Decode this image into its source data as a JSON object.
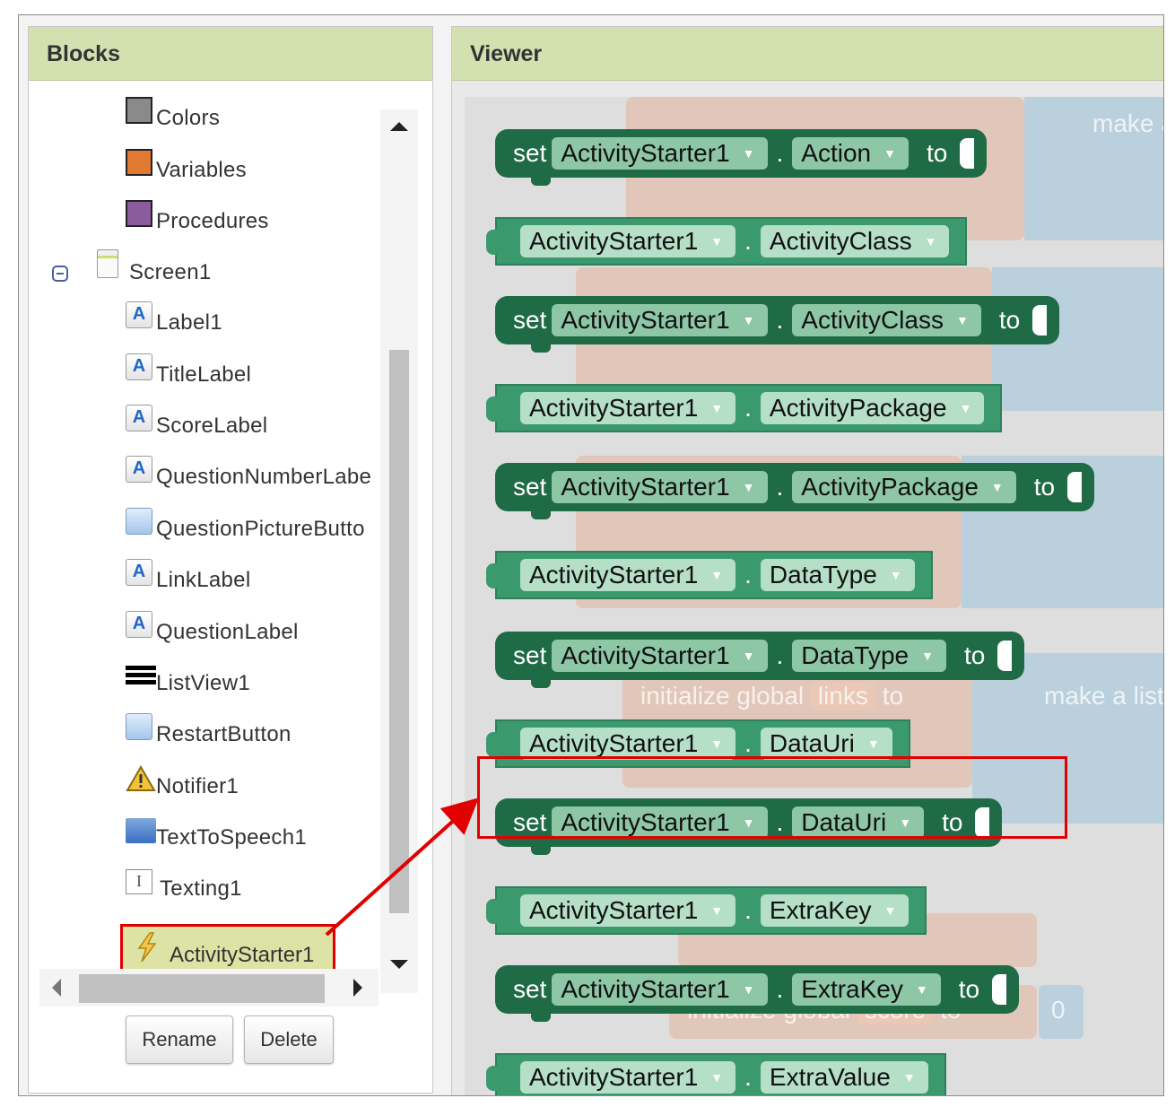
{
  "blocks_panel": {
    "title": "Blocks",
    "built_in": [
      {
        "label": "Colors",
        "color": "#8a8a8a"
      },
      {
        "label": "Variables",
        "color": "#e07a33"
      },
      {
        "label": "Procedures",
        "color": "#8a5c9e"
      }
    ],
    "screen": {
      "label": "Screen1"
    },
    "components": [
      {
        "label": "Label1",
        "icon": "label-icon"
      },
      {
        "label": "TitleLabel",
        "icon": "label-icon"
      },
      {
        "label": "ScoreLabel",
        "icon": "label-icon"
      },
      {
        "label": "QuestionNumberLabe",
        "icon": "label-icon"
      },
      {
        "label": "QuestionPictureButto",
        "icon": "button-icon"
      },
      {
        "label": "LinkLabel",
        "icon": "label-icon"
      },
      {
        "label": "QuestionLabel",
        "icon": "label-icon"
      },
      {
        "label": "ListView1",
        "icon": "listview-icon"
      },
      {
        "label": "RestartButton",
        "icon": "button-icon"
      },
      {
        "label": "Notifier1",
        "icon": "warning-icon"
      },
      {
        "label": "TextToSpeech1",
        "icon": "speech-icon"
      },
      {
        "label": "Texting1",
        "icon": "texting-icon"
      },
      {
        "label": "ActivityStarter1",
        "icon": "bolt-icon"
      }
    ],
    "rename_label": "Rename",
    "delete_label": "Delete"
  },
  "viewer": {
    "title": "Viewer",
    "component": "ActivityStarter1",
    "set_word": "set",
    "to_word": "to",
    "dot": ".",
    "blocks": [
      {
        "kind": "set",
        "property": "Action"
      },
      {
        "kind": "get",
        "property": "ActivityClass"
      },
      {
        "kind": "set",
        "property": "ActivityClass"
      },
      {
        "kind": "get",
        "property": "ActivityPackage"
      },
      {
        "kind": "set",
        "property": "ActivityPackage"
      },
      {
        "kind": "get",
        "property": "DataType"
      },
      {
        "kind": "set",
        "property": "DataType"
      },
      {
        "kind": "get",
        "property": "DataUri"
      },
      {
        "kind": "set",
        "property": "DataUri"
      },
      {
        "kind": "get",
        "property": "ExtraKey"
      },
      {
        "kind": "set",
        "property": "ExtraKey"
      },
      {
        "kind": "get",
        "property": "ExtraValue"
      }
    ],
    "background_blocks": {
      "make_a_list": "make a list",
      "init_links": "initialize global",
      "links_var": "links",
      "init_score": "initialize global",
      "score_var": "score",
      "score_value": "0",
      "to_word": "to"
    }
  },
  "colors": {
    "header_bg": "#d3e0b0",
    "get_block": "#3a9a6e",
    "set_block": "#1f6b45",
    "highlight": "#e00000"
  }
}
